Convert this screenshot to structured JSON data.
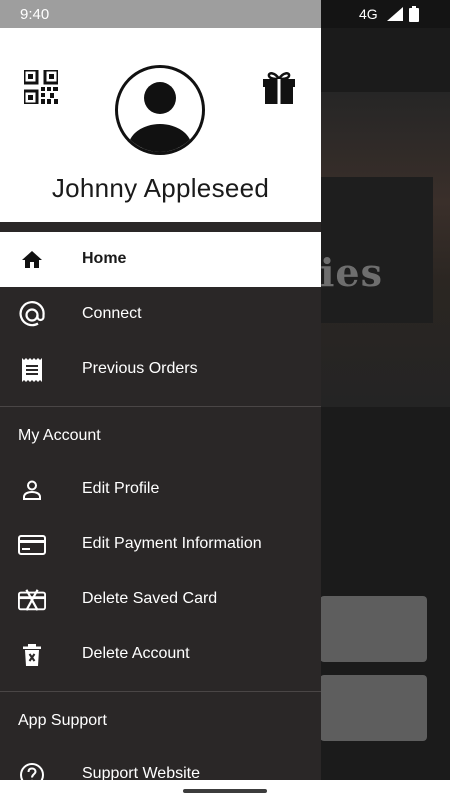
{
  "status_bar": {
    "time": "9:40",
    "network": "4G"
  },
  "background_app": {
    "hero_text": "ies"
  },
  "drawer": {
    "user": {
      "name": "Johnny Appleseed"
    },
    "items": [
      {
        "label": "Home",
        "icon": "home-icon",
        "active": true
      },
      {
        "label": "Connect",
        "icon": "at-icon"
      },
      {
        "label": "Previous Orders",
        "icon": "receipt-icon"
      }
    ],
    "sections": [
      {
        "title": "My Account",
        "items": [
          {
            "label": "Edit Profile",
            "icon": "person-icon"
          },
          {
            "label": "Edit Payment Information",
            "icon": "credit-card-icon"
          },
          {
            "label": "Delete Saved Card",
            "icon": "card-delete-icon"
          },
          {
            "label": "Delete Account",
            "icon": "trash-icon"
          }
        ]
      },
      {
        "title": "App Support",
        "items": [
          {
            "label": "Support Website",
            "icon": "help-icon"
          }
        ]
      }
    ]
  },
  "colors": {
    "drawer_bg": "#2a2727",
    "header_bg": "#ffffff",
    "status_bg": "#9e9e9e",
    "text_light": "#ffffff",
    "text_dark": "#1a1a1a"
  }
}
